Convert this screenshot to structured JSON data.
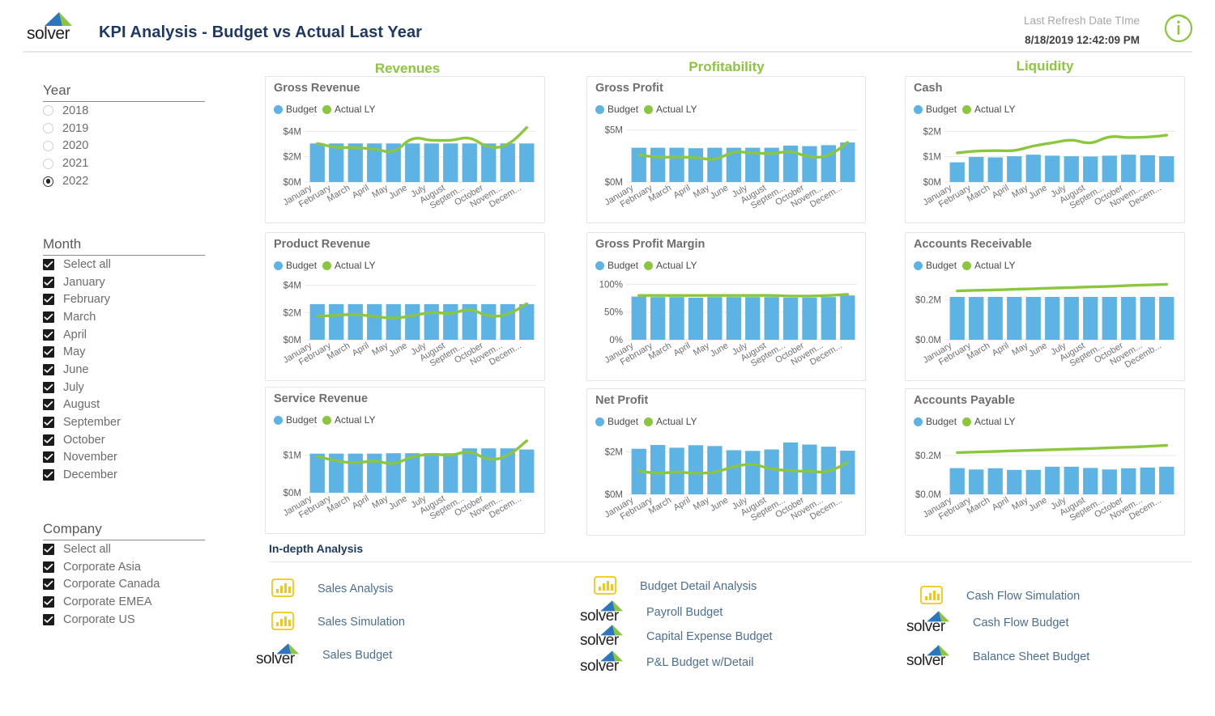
{
  "header": {
    "logo_text": "solver",
    "title": "KPI Analysis - Budget vs Actual Last Year",
    "refresh_label": "Last Refresh Date TIme",
    "refresh_value": "8/18/2019 12:42:09 PM",
    "info_icon": "info-circle-icon"
  },
  "colors": {
    "budget_bar": "#5cb3e4",
    "actual_line": "#8cc63e",
    "section_header": "#8cc63e",
    "title_navy": "#1f3864",
    "link_blue": "#4a6f93",
    "pbi_yellow": "#f2c811"
  },
  "filters": {
    "year": {
      "title": "Year",
      "type": "radio",
      "options": [
        "2018",
        "2019",
        "2020",
        "2021",
        "2022"
      ],
      "selected": "2022"
    },
    "month": {
      "title": "Month",
      "type": "checkbox",
      "options": [
        "Select all",
        "January",
        "February",
        "March",
        "April",
        "May",
        "June",
        "July",
        "August",
        "September",
        "October",
        "November",
        "December"
      ],
      "checked": [
        "Select all",
        "January",
        "February",
        "March",
        "April",
        "May",
        "June",
        "July",
        "August",
        "September",
        "October",
        "November",
        "December"
      ]
    },
    "company": {
      "title": "Company",
      "type": "checkbox",
      "options": [
        "Select all",
        "Corporate Asia",
        "Corporate Canada",
        "Corporate EMEA",
        "Corporate US"
      ],
      "checked": [
        "Select all",
        "Corporate Asia",
        "Corporate Canada",
        "Corporate EMEA",
        "Corporate US"
      ]
    }
  },
  "sections": [
    {
      "label": "Revenues"
    },
    {
      "label": "Profitability"
    },
    {
      "label": "Liquidity"
    }
  ],
  "legend": {
    "budget": "Budget",
    "actual": "Actual LY"
  },
  "chart_data": [
    {
      "type": "bar",
      "title": "Gross Revenue",
      "section": "Revenues",
      "categories": [
        "January",
        "February",
        "March",
        "April",
        "May",
        "June",
        "July",
        "August",
        "Septem...",
        "October",
        "Novem...",
        "Decem..."
      ],
      "series": [
        {
          "name": "Budget",
          "kind": "bar",
          "values": [
            3.05,
            3.05,
            3.05,
            3.05,
            3.05,
            3.05,
            3.05,
            3.05,
            3.05,
            3.05,
            3.05,
            3.05
          ]
        },
        {
          "name": "Actual LY",
          "kind": "line",
          "values": [
            3.05,
            2.75,
            2.72,
            2.6,
            2.45,
            3.4,
            3.3,
            3.3,
            3.45,
            2.8,
            3.0,
            4.3
          ]
        }
      ],
      "ylabel": "",
      "xlabel": "",
      "ytick_labels": [
        "$0M",
        "$2M",
        "$4M"
      ],
      "ytick_values": [
        0,
        2,
        4
      ],
      "ylim": [
        0,
        4.6
      ],
      "grid": true
    },
    {
      "type": "bar",
      "title": "Gross Profit",
      "section": "Profitability",
      "categories": [
        "January",
        "February",
        "March",
        "April",
        "May",
        "June",
        "July",
        "August",
        "Septem...",
        "October",
        "Novem...",
        "Decem..."
      ],
      "series": [
        {
          "name": "Budget",
          "kind": "bar",
          "values": [
            3.3,
            3.3,
            3.3,
            3.25,
            3.3,
            3.3,
            3.3,
            3.3,
            3.5,
            3.45,
            3.55,
            3.8
          ]
        },
        {
          "name": "Actual LY",
          "kind": "line",
          "values": [
            2.6,
            2.4,
            2.4,
            2.35,
            2.2,
            2.85,
            2.8,
            2.75,
            2.9,
            2.45,
            2.6,
            3.8
          ]
        }
      ],
      "ylabel": "",
      "xlabel": "",
      "ytick_labels": [
        "$0M",
        "$5M"
      ],
      "ytick_values": [
        0,
        5
      ],
      "ylim": [
        0,
        5.6
      ],
      "grid": true
    },
    {
      "type": "bar",
      "title": "Cash",
      "section": "Liquidity",
      "categories": [
        "January",
        "February",
        "March",
        "April",
        "May",
        "June",
        "July",
        "August",
        "Septem...",
        "October",
        "Novem...",
        "Decem..."
      ],
      "series": [
        {
          "name": "Budget",
          "kind": "bar",
          "values": [
            0.78,
            0.99,
            0.97,
            1.02,
            1.08,
            1.04,
            1.02,
            1.01,
            1.04,
            1.08,
            1.06,
            1.02
          ]
        },
        {
          "name": "Actual LY",
          "kind": "line",
          "values": [
            1.15,
            1.22,
            1.24,
            1.25,
            1.42,
            1.55,
            1.65,
            1.55,
            1.78,
            1.76,
            1.78,
            1.85
          ]
        }
      ],
      "ylabel": "",
      "xlabel": "",
      "ytick_labels": [
        "$0M",
        "$1M",
        "$2M"
      ],
      "ytick_values": [
        0,
        1,
        2
      ],
      "ylim": [
        0,
        2.3
      ],
      "grid": true
    },
    {
      "type": "bar",
      "title": "Product Revenue",
      "section": "Revenues",
      "categories": [
        "January",
        "February",
        "March",
        "April",
        "May",
        "June",
        "July",
        "August",
        "Septem...",
        "October",
        "Novem...",
        "Decem..."
      ],
      "series": [
        {
          "name": "Budget",
          "kind": "bar",
          "values": [
            2.62,
            2.62,
            2.62,
            2.62,
            2.62,
            2.62,
            2.62,
            2.62,
            2.62,
            2.62,
            2.62,
            2.62
          ]
        },
        {
          "name": "Actual LY",
          "kind": "line",
          "values": [
            1.72,
            1.8,
            1.85,
            1.72,
            1.6,
            1.78,
            2.0,
            1.95,
            2.2,
            1.78,
            1.9,
            2.65
          ]
        }
      ],
      "ylabel": "",
      "xlabel": "",
      "ytick_labels": [
        "$0M",
        "$2M",
        "$4M"
      ],
      "ytick_values": [
        0,
        2,
        4
      ],
      "ylim": [
        0,
        4.4
      ],
      "grid": true
    },
    {
      "type": "bar",
      "title": "Gross Profit Margin",
      "section": "Profitability",
      "categories": [
        "January",
        "February",
        "March",
        "April",
        "May",
        "June",
        "July",
        "August",
        "Septem...",
        "October",
        "Novem...",
        "Decem..."
      ],
      "series": [
        {
          "name": "Budget",
          "kind": "bar",
          "values": [
            78,
            77,
            77,
            76,
            77,
            77,
            77,
            77,
            76,
            76,
            77,
            80
          ]
        },
        {
          "name": "Actual LY",
          "kind": "line",
          "values": [
            80,
            80,
            80,
            80,
            80,
            80,
            80,
            80,
            79,
            79,
            80,
            82
          ]
        }
      ],
      "ylabel": "",
      "xlabel": "",
      "ytick_labels": [
        "0%",
        "50%",
        "100%"
      ],
      "ytick_values": [
        0,
        50,
        100
      ],
      "ylim": [
        0,
        108
      ],
      "grid": true
    },
    {
      "type": "bar",
      "title": "Accounts Receivable",
      "section": "Liquidity",
      "categories": [
        "January",
        "February",
        "March",
        "April",
        "May",
        "June",
        "July",
        "August",
        "Septem...",
        "October",
        "Novem...",
        "Decemb..."
      ],
      "series": [
        {
          "name": "Budget",
          "kind": "bar",
          "values": [
            0.215,
            0.215,
            0.215,
            0.215,
            0.215,
            0.215,
            0.215,
            0.215,
            0.215,
            0.215,
            0.215,
            0.215
          ]
        },
        {
          "name": "Actual LY",
          "kind": "line",
          "values": [
            0.245,
            0.248,
            0.25,
            0.253,
            0.256,
            0.259,
            0.262,
            0.265,
            0.268,
            0.272,
            0.275,
            0.278
          ]
        }
      ],
      "ylabel": "",
      "xlabel": "",
      "ytick_labels": [
        "$0.0M",
        "$0.2M"
      ],
      "ytick_values": [
        0,
        0.2
      ],
      "ylim": [
        0,
        0.3
      ],
      "grid": true
    },
    {
      "type": "bar",
      "title": "Service Revenue",
      "section": "Revenues",
      "categories": [
        "January",
        "February",
        "March",
        "April",
        "May",
        "June",
        "July",
        "August",
        "Septem...",
        "October",
        "Novem...",
        "Decem..."
      ],
      "series": [
        {
          "name": "Budget",
          "kind": "bar",
          "values": [
            1.04,
            1.04,
            1.04,
            1.04,
            1.05,
            1.05,
            1.05,
            1.05,
            1.18,
            1.18,
            1.18,
            1.15
          ]
        },
        {
          "name": "Actual LY",
          "kind": "line",
          "values": [
            0.97,
            0.85,
            0.8,
            0.84,
            0.78,
            0.95,
            1.02,
            1.0,
            1.08,
            0.9,
            1.0,
            1.38
          ]
        }
      ],
      "ylabel": "",
      "xlabel": "",
      "ytick_labels": [
        "$0M",
        "$1M"
      ],
      "ytick_values": [
        0,
        1
      ],
      "ylim": [
        0,
        1.55
      ],
      "grid": true
    },
    {
      "type": "bar",
      "title": "Net Profit",
      "section": "Profitability",
      "categories": [
        "January",
        "February",
        "March",
        "April",
        "May",
        "June",
        "July",
        "August",
        "Septem...",
        "October",
        "Novem...",
        "Decem..."
      ],
      "series": [
        {
          "name": "Budget",
          "kind": "bar",
          "values": [
            2.15,
            2.33,
            2.2,
            2.32,
            2.28,
            2.08,
            2.05,
            2.12,
            2.45,
            2.35,
            2.25,
            2.06
          ]
        },
        {
          "name": "Actual LY",
          "kind": "line",
          "values": [
            1.1,
            1.0,
            1.05,
            1.0,
            1.05,
            1.3,
            1.4,
            1.2,
            1.12,
            1.08,
            1.1,
            1.5
          ]
        }
      ],
      "ylabel": "",
      "xlabel": "",
      "ytick_labels": [
        "$0M",
        "$2M"
      ],
      "ytick_values": [
        0,
        2
      ],
      "ylim": [
        0,
        2.75
      ],
      "grid": true
    },
    {
      "type": "bar",
      "title": "Accounts Payable",
      "section": "Liquidity",
      "categories": [
        "January",
        "February",
        "March",
        "April",
        "May",
        "June",
        "July",
        "August",
        "Septem...",
        "October",
        "Novem...",
        "Decem..."
      ],
      "series": [
        {
          "name": "Budget",
          "kind": "bar",
          "values": [
            0.135,
            0.128,
            0.134,
            0.126,
            0.126,
            0.142,
            0.142,
            0.136,
            0.128,
            0.134,
            0.138,
            0.142
          ]
        },
        {
          "name": "Actual LY",
          "kind": "line",
          "values": [
            0.215,
            0.218,
            0.221,
            0.224,
            0.227,
            0.23,
            0.233,
            0.236,
            0.24,
            0.243,
            0.247,
            0.252
          ]
        }
      ],
      "ylabel": "",
      "xlabel": "",
      "ytick_labels": [
        "$0.0M",
        "$0.2M"
      ],
      "ytick_values": [
        0,
        0.2
      ],
      "ylim": [
        0,
        0.3
      ],
      "grid": true
    }
  ],
  "indepth": {
    "title": "In-depth Analysis",
    "columns": [
      {
        "links": [
          {
            "label": "Sales  Analysis",
            "icon": "powerbi-icon"
          },
          {
            "label": "Sales Simulation",
            "icon": "powerbi-icon"
          },
          {
            "label": "Sales Budget",
            "icon": "solver-logo-icon"
          }
        ]
      },
      {
        "links": [
          {
            "label": "Budget Detail Analysis",
            "icon": "powerbi-icon"
          },
          {
            "label": "Payroll Budget",
            "icon": "solver-logo-icon"
          },
          {
            "label": "Capital Expense Budget",
            "icon": "solver-logo-icon"
          },
          {
            "label": "P&L Budget w/Detail",
            "icon": "solver-logo-icon"
          }
        ]
      },
      {
        "links": [
          {
            "label": "Cash Flow Simulation",
            "icon": "powerbi-icon"
          },
          {
            "label": "Cash Flow Budget",
            "icon": "solver-logo-icon"
          },
          {
            "label": "Balance Sheet Budget",
            "icon": "solver-logo-icon"
          }
        ]
      }
    ]
  }
}
